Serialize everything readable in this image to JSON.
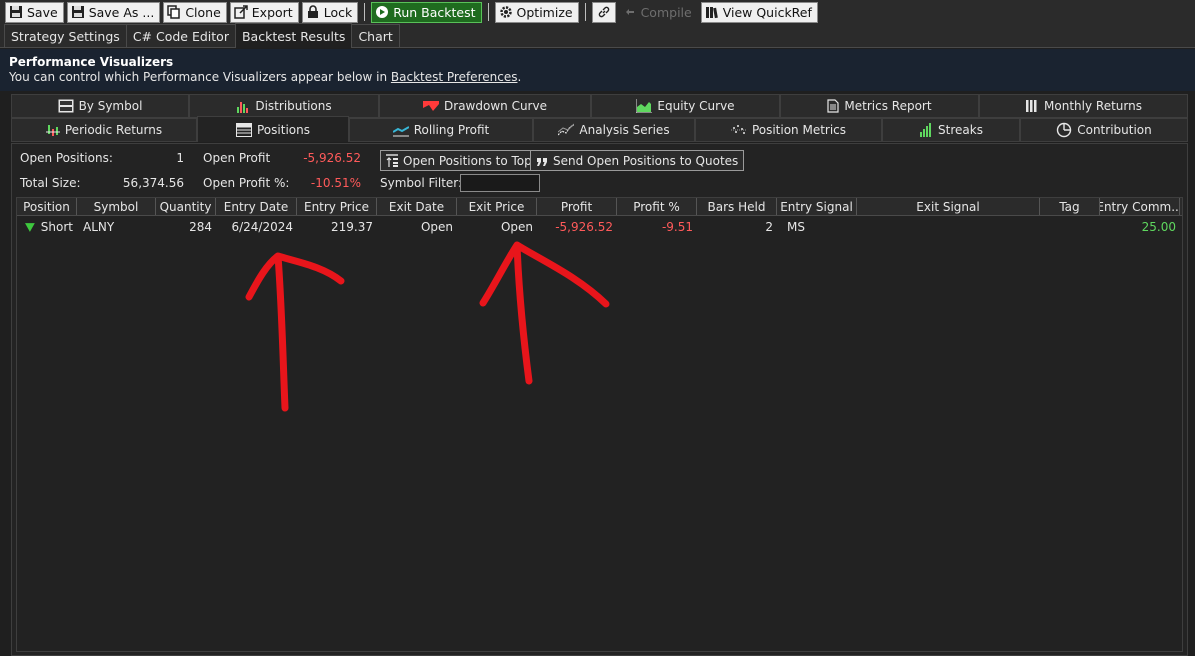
{
  "toolbar": {
    "save": "Save",
    "save_as": "Save As ...",
    "clone": "Clone",
    "export": "Export",
    "lock": "Lock",
    "run_backtest": "Run Backtest",
    "optimize": "Optimize",
    "compile": "Compile",
    "view_quickref": "View QuickRef"
  },
  "main_tabs": [
    "Strategy Settings",
    "C# Code Editor",
    "Backtest Results",
    "Chart"
  ],
  "header": {
    "title": "Performance Visualizers",
    "desc_prefix": "You can control which Performance Visualizers appear below in ",
    "desc_link": "Backtest Preferences",
    "desc_suffix": "."
  },
  "viz_tabs_row1": [
    "By Symbol",
    "Distributions",
    "Drawdown Curve",
    "Equity Curve",
    "Metrics Report",
    "Monthly Returns"
  ],
  "viz_tabs_row2": [
    "Periodic Returns",
    "Positions",
    "Rolling Profit",
    "Analysis Series",
    "Position Metrics",
    "Streaks",
    "Contribution"
  ],
  "summary": {
    "open_positions_label": "Open Positions:",
    "open_positions": "1",
    "total_size_label": "Total Size:",
    "total_size": "56,374.56",
    "open_profit_label": "Open Profit",
    "open_profit": "-5,926.52",
    "open_profit_pct_label": "Open Profit %:",
    "open_profit_pct": "-10.51%",
    "symbol_filter_label": "Symbol Filter:",
    "symbol_filter_value": "",
    "btn_top": "Open Positions to Top",
    "btn_quotes": "Send Open Positions to Quotes"
  },
  "grid": {
    "columns": [
      "Position",
      "Symbol",
      "Quantity",
      "Entry Date",
      "Entry Price",
      "Exit Date",
      "Exit Price",
      "Profit",
      "Profit %",
      "Bars Held",
      "Entry Signal",
      "Exit Signal",
      "Tag",
      "Entry Comm..."
    ],
    "rows": [
      {
        "position": "Short",
        "symbol": "ALNY",
        "quantity": "284",
        "entry_date": "6/24/2024",
        "entry_price": "219.37",
        "exit_date": "Open",
        "exit_price": "Open",
        "profit": "-5,926.52",
        "profit_pct": "-9.51",
        "bars_held": "2",
        "entry_signal": "MS",
        "exit_signal": "",
        "tag": "",
        "entry_comm": "25.00"
      }
    ]
  },
  "colors": {
    "negative": "#ff5a5a",
    "positive": "#5fd75f",
    "run_button": "#1f6b1f",
    "annotation": "#e8151b"
  }
}
